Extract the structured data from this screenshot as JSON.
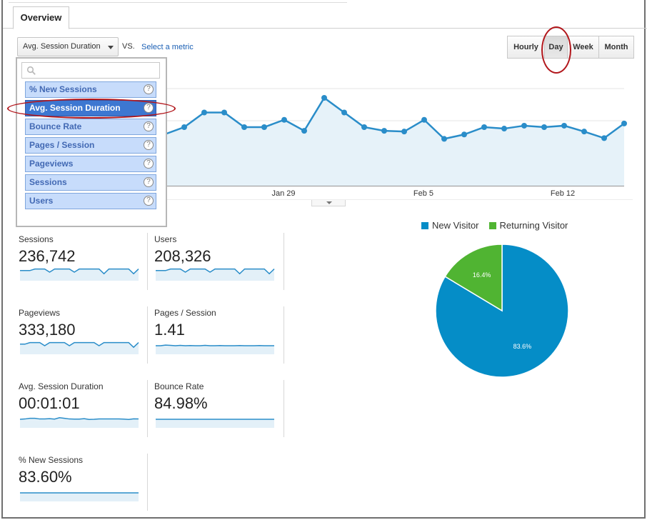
{
  "tabs": [
    {
      "label": "Overview"
    }
  ],
  "controls": {
    "metric_select": "Avg. Session Duration",
    "vs_label": "VS.",
    "select_metric_link": "Select a metric",
    "granularity": [
      "Hourly",
      "Day",
      "Week",
      "Month"
    ],
    "granularity_active": "Day"
  },
  "dropdown": {
    "search_placeholder": "",
    "items": [
      {
        "label": "% New Sessions"
      },
      {
        "label": "Avg. Session Duration"
      },
      {
        "label": "Bounce Rate"
      },
      {
        "label": "Pages / Session"
      },
      {
        "label": "Pageviews"
      },
      {
        "label": "Sessions"
      },
      {
        "label": "Users"
      }
    ],
    "selected_index": 1,
    "help_glyph": "?"
  },
  "chart_data": {
    "type": "area",
    "x_tick_labels": [
      "Jan 29",
      "Feb 5",
      "Feb 12"
    ],
    "values": [
      19,
      20,
      22,
      22,
      20,
      20,
      21,
      19.5,
      24,
      22,
      20,
      19.5,
      19.4,
      21,
      18.4,
      19,
      20,
      19.8,
      20.2,
      20,
      20.2,
      19.4,
      18.5,
      20.5
    ],
    "ylim": [
      12,
      28
    ],
    "color": "#2a8dc9"
  },
  "tiles": [
    {
      "label": "Sessions",
      "value": "236,742",
      "spark": [
        6,
        6,
        6,
        7,
        7,
        7,
        5,
        7,
        7,
        7,
        7,
        5,
        7,
        7,
        7,
        7,
        7,
        4,
        7,
        7,
        7,
        7,
        7,
        4,
        7
      ]
    },
    {
      "label": "Users",
      "value": "208,326",
      "spark": [
        6,
        6,
        6,
        7,
        7,
        7,
        5,
        7,
        7,
        7,
        7,
        5,
        7,
        7,
        7,
        7,
        7,
        4,
        7,
        7,
        7,
        7,
        7,
        4,
        7
      ]
    },
    {
      "label": "Pageviews",
      "value": "333,180",
      "spark": [
        6,
        6,
        7,
        7,
        7,
        5,
        7,
        7,
        7,
        7,
        5,
        7,
        7,
        7,
        7,
        7,
        5,
        7,
        7,
        7,
        7,
        7,
        7,
        4,
        7
      ]
    },
    {
      "label": "Pages / Session",
      "value": "1.41",
      "spark": [
        5,
        5,
        5.4,
        5.2,
        5,
        5.2,
        5,
        5.1,
        5,
        5,
        5.2,
        5,
        5,
        5.1,
        5,
        5,
        5,
        5.1,
        5,
        5,
        5,
        5.1,
        5,
        5,
        5
      ]
    },
    {
      "label": "Avg. Session Duration",
      "value": "00:01:01",
      "spark": [
        5,
        5.2,
        5.6,
        5.6,
        5.2,
        5.2,
        5.4,
        5.1,
        6,
        5.6,
        5.2,
        5.1,
        5.1,
        5.4,
        4.9,
        5,
        5.2,
        5.2,
        5.2,
        5.2,
        5.2,
        5.1,
        4.9,
        5.3,
        5.2
      ]
    },
    {
      "label": "Bounce Rate",
      "value": "84.98%",
      "spark": [
        5,
        5,
        5,
        5,
        5,
        5,
        5,
        5,
        5,
        5,
        5,
        5,
        5,
        5,
        5,
        5,
        5,
        5,
        5,
        5,
        5,
        5,
        5,
        5,
        5
      ]
    },
    {
      "label": "% New Sessions",
      "value": "83.60%",
      "spark": [
        5,
        5,
        5,
        5,
        5,
        5,
        5,
        5,
        5,
        5,
        5,
        5,
        5,
        5,
        5,
        5,
        5,
        5,
        5,
        5,
        5,
        5,
        5,
        5,
        5
      ]
    }
  ],
  "pie": {
    "legend": [
      {
        "name": "New Visitor",
        "color": "#058dc7"
      },
      {
        "name": "Returning Visitor",
        "color": "#50b432"
      }
    ],
    "slices": [
      {
        "name": "New Visitor",
        "value": 83.6,
        "label": "83.6%",
        "color": "#058dc7"
      },
      {
        "name": "Returning Visitor",
        "value": 16.4,
        "label": "16.4%",
        "color": "#50b432"
      }
    ]
  }
}
